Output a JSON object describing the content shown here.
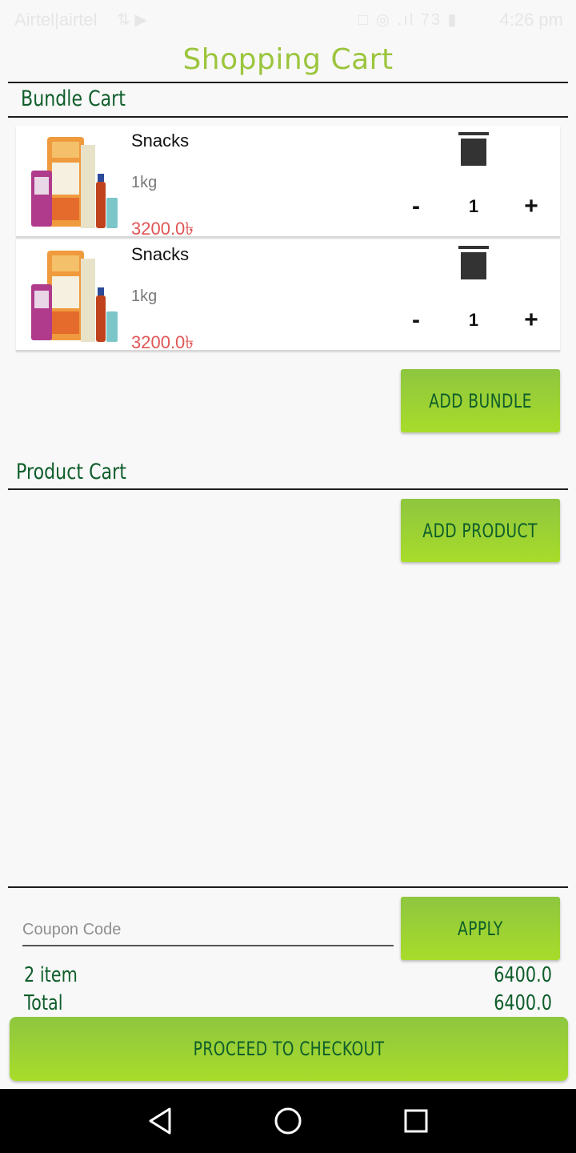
{
  "status_bar": {
    "carrier": "Airtel|airtel",
    "carrier_icons": "⇅ ▶",
    "sys_icons": "□ ◎ .ıl 73 ▮",
    "time": "4:26 pm"
  },
  "header": {
    "title": "Shopping Cart"
  },
  "bundle_cart": {
    "title": "Bundle Cart",
    "items": [
      {
        "name": "Snacks",
        "weight": "1kg",
        "price": "3200.0৳",
        "qty": "1",
        "minus": "-",
        "plus": "+",
        "image_icon": "grocery-bundle-image",
        "trash_icon": "trash-icon"
      },
      {
        "name": "Snacks",
        "weight": "1kg",
        "price": "3200.0৳",
        "qty": "1",
        "minus": "-",
        "plus": "+",
        "image_icon": "grocery-bundle-image",
        "trash_icon": "trash-icon"
      }
    ],
    "add_button": "ADD BUNDLE"
  },
  "product_cart": {
    "title": "Product Cart",
    "add_button": "ADD PRODUCT"
  },
  "coupon": {
    "placeholder": "Coupon Code",
    "apply_button": "APPLY"
  },
  "summary": {
    "items_label": "2 item",
    "items_value": "6400.0",
    "total_label": "Total",
    "total_value": "6400.0"
  },
  "checkout": {
    "button": "PROCEED TO CHECKOUT"
  },
  "nav": {
    "back_icon": "back-triangle-icon",
    "home_icon": "home-circle-icon",
    "recents_icon": "recents-square-icon"
  },
  "colors": {
    "title_green": "#9bc53d",
    "dark_green": "#0f5e2b",
    "button_green_top": "#8ec63f",
    "button_green_bottom": "#a8dc2a",
    "price_red": "#e05555"
  }
}
